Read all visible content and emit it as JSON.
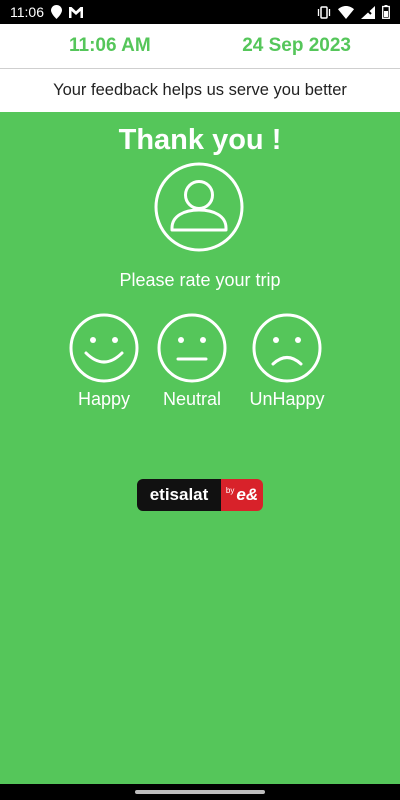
{
  "status_bar": {
    "time": "11:06",
    "left_icons": [
      "location-pin-icon",
      "gmail-icon"
    ],
    "right_icons": [
      "vibrate-icon",
      "wifi-icon",
      "signal-no-data-icon",
      "battery-icon"
    ]
  },
  "header": {
    "time": "11:06 AM",
    "date": "24 Sep 2023"
  },
  "banner": {
    "text": "Your feedback helps us serve you better"
  },
  "main": {
    "title": "Thank you !",
    "avatar_icon": "user-icon",
    "prompt": "Please rate your trip",
    "ratings": [
      {
        "label": "Happy",
        "icon": "happy-face-icon"
      },
      {
        "label": "Neutral",
        "icon": "neutral-face-icon"
      },
      {
        "label": "UnHappy",
        "icon": "unhappy-face-icon"
      }
    ]
  },
  "logo": {
    "name": "etisalat",
    "by": "by",
    "mark": "e&"
  },
  "colors": {
    "accent": "#55c65a",
    "logo_red": "#d8222a",
    "logo_black": "#111111"
  }
}
